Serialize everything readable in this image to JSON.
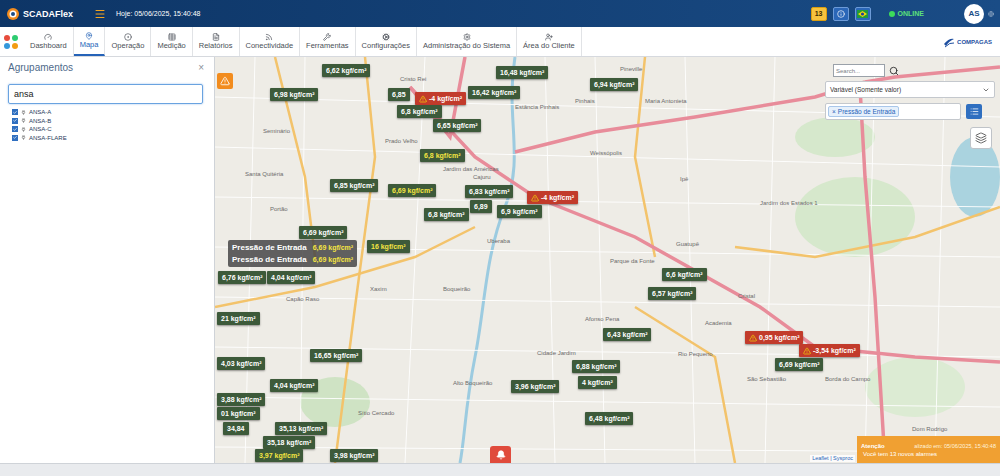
{
  "header": {
    "logo": "SCADAFlex",
    "date": "Hoje: 05/06/2025, 15:40:48",
    "alarm_count": "13",
    "status": "ONLINE",
    "avatar": "AS"
  },
  "nav": {
    "tabs": [
      {
        "label": "Dashboard",
        "selected": false
      },
      {
        "label": "Mapa",
        "selected": true
      },
      {
        "label": "Operação",
        "selected": false
      },
      {
        "label": "Medição",
        "selected": false
      },
      {
        "label": "Relatórios",
        "selected": false
      },
      {
        "label": "Conectividade",
        "selected": false
      },
      {
        "label": "Ferramentas",
        "selected": false
      },
      {
        "label": "Configurações",
        "selected": false
      },
      {
        "label": "Administração do Sistema",
        "selected": false
      },
      {
        "label": "Área do Cliente",
        "selected": false
      }
    ],
    "brand": "COMPAGAS"
  },
  "sidebar": {
    "title": "Agrupamentos",
    "close": "×",
    "search": "ansa",
    "items": [
      {
        "label": "ANSA-A",
        "checked": true
      },
      {
        "label": "ANSA-B",
        "checked": true
      },
      {
        "label": "ANSA-C",
        "checked": true
      },
      {
        "label": "ANSA-FLARE",
        "checked": true
      }
    ]
  },
  "map": {
    "search_placeholder": "Search...",
    "variable_select": "Variável (Somente valor)",
    "filter_tags": [
      {
        "label": "Pressão de Entrada",
        "remove": "×"
      }
    ],
    "places": [
      "Cristo Rei",
      "Estância Pinhais",
      "Pinhais",
      "Pineville",
      "Maria Antonieta",
      "Weissópolis",
      "Jardim das Américas",
      "Cajuru",
      "Prado Velho",
      "Seminário",
      "Santa Quitéria",
      "Portão",
      "Uberaba",
      "Guatupê",
      "Parque da Fonte",
      "Ipê",
      "Jardim dos Estados 1",
      "Xaxim",
      "Boqueirão",
      "Capão Raso",
      "Afonso Pena",
      "Academia",
      "Cristal",
      "Rio Pequeno",
      "São Sebastião",
      "Borda do Campo",
      "Sítio Cercado",
      "Alto Boqueirão",
      "Dom Rodrigo",
      "Cidade Jardim"
    ],
    "markers": [
      {
        "value": "6,62 kgf/cm²",
        "kind": "normal",
        "color": "#ffffff"
      },
      {
        "value": "6,98 kgf/cm²",
        "kind": "normal",
        "color": "#ffffff"
      },
      {
        "value": "6,85",
        "kind": "normal",
        "color": "#ffffff"
      },
      {
        "value": "-4 kgf/cm²",
        "kind": "alarm",
        "color": "#ffffff"
      },
      {
        "value": "16,42 kgf/cm²",
        "kind": "normal",
        "color": "#ffffff"
      },
      {
        "value": "16,48 kgf/cm²",
        "kind": "normal",
        "color": "#ffffff"
      },
      {
        "value": "6,94 kgf/cm²",
        "kind": "normal",
        "color": "#ffffff"
      },
      {
        "value": "6,8 kgf/cm²",
        "kind": "normal",
        "color": "#ffffff"
      },
      {
        "value": "6,65 kgf/cm²",
        "kind": "normal",
        "color": "#ffffff"
      },
      {
        "value": "6,8 kgf/cm²",
        "kind": "normal",
        "color": "#f5e642"
      },
      {
        "value": "6,85 kgf/cm²",
        "kind": "normal",
        "color": "#ffffff"
      },
      {
        "value": "6,69 kgf/cm²",
        "kind": "normal",
        "color": "#f5e642"
      },
      {
        "value": "6,83 kgf/cm²",
        "kind": "normal",
        "color": "#ffffff"
      },
      {
        "value": "6,89",
        "kind": "normal",
        "color": "#ffffff"
      },
      {
        "value": "-4 kgf/cm²",
        "kind": "alarm",
        "color": "#ffffff"
      },
      {
        "value": "6,8 kgf/cm²",
        "kind": "normal",
        "color": "#ffffff"
      },
      {
        "value": "6,9 kgf/cm²",
        "kind": "normal",
        "color": "#ffffff"
      },
      {
        "value": "6,69 kgf/cm²",
        "kind": "normal",
        "color": "#ffffff"
      },
      {
        "value": "16 kgf/cm²",
        "kind": "normal",
        "color": "#f5e642"
      },
      {
        "value": "6,76 kgf/cm²",
        "kind": "normal",
        "color": "#ffffff"
      },
      {
        "value": "4,04 kgf/cm²",
        "kind": "normal",
        "color": "#ffffff"
      },
      {
        "value": "21 kgf/cm²",
        "kind": "normal",
        "color": "#ffffff"
      },
      {
        "value": "6,6 kgf/cm²",
        "kind": "normal",
        "color": "#ffffff"
      },
      {
        "value": "6,57 kgf/cm²",
        "kind": "normal",
        "color": "#ffffff"
      },
      {
        "value": "6,43 kgf/cm²",
        "kind": "normal",
        "color": "#ffffff"
      },
      {
        "value": "0,95 kgf/cm²",
        "kind": "alarm",
        "color": "#ffffff"
      },
      {
        "value": "-3,54 kgf/cm²",
        "kind": "alarm",
        "color": "#ffffff"
      },
      {
        "value": "6,69 kgf/cm²",
        "kind": "normal",
        "color": "#ffffff"
      },
      {
        "value": "16,65 kgf/cm²",
        "kind": "normal",
        "color": "#ffffff"
      },
      {
        "value": "4,03 kgf/cm²",
        "kind": "normal",
        "color": "#ffffff"
      },
      {
        "value": "6,88 kgf/cm²",
        "kind": "normal",
        "color": "#ffffff"
      },
      {
        "value": "4 kgf/cm²",
        "kind": "normal",
        "color": "#ffffff"
      },
      {
        "value": "3,96 kgf/cm²",
        "kind": "normal",
        "color": "#ffffff"
      },
      {
        "value": "3,88 kgf/cm²",
        "kind": "normal",
        "color": "#ffffff"
      },
      {
        "value": "4,04 kgf/cm²",
        "kind": "normal",
        "color": "#ffffff"
      },
      {
        "value": "6,48 kgf/cm²",
        "kind": "normal",
        "color": "#ffffff"
      },
      {
        "value": "01 kgf/cm²",
        "kind": "normal",
        "color": "#ffffff"
      },
      {
        "value": "34,84",
        "kind": "normal",
        "color": "#ffffff"
      },
      {
        "value": "35,13 kgf/cm²",
        "kind": "normal",
        "color": "#ffffff"
      },
      {
        "value": "35,18 kgf/cm²",
        "kind": "normal",
        "color": "#ffffff"
      },
      {
        "value": "3,97 kgf/cm²",
        "kind": "normal",
        "color": "#f5e642"
      },
      {
        "value": "3,98 kgf/cm²",
        "kind": "normal",
        "color": "#ffffff"
      }
    ],
    "tooltip": {
      "rows": [
        {
          "label": "Pressão de Entrada",
          "value": "6,69 kgf/cm²"
        },
        {
          "label": "Pressão de Entrada",
          "value": "6,69 kgf/cm²"
        }
      ]
    },
    "attribution": "Leaflet | Sysproc"
  },
  "notification": {
    "title": "Atenção",
    "time": "alizado em: 05/06/2025, 15:40:48",
    "message": "Você tem 13 novos alarmes"
  }
}
